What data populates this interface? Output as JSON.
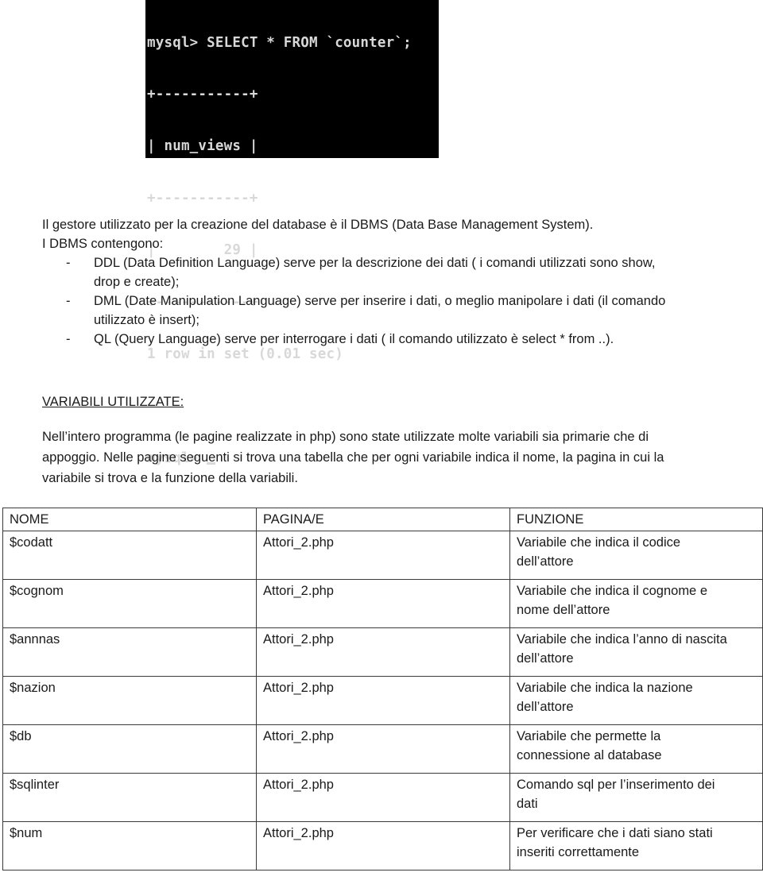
{
  "terminal": {
    "lines": [
      "mysql> SELECT * FROM `counter`;",
      "+-----------+",
      "| num_views |",
      "+-----------+",
      "|        29 |",
      "+-----------+",
      "1 row in set (0.01 sec)",
      "",
      "mysql> "
    ]
  },
  "intro": {
    "line1": "Il gestore utilizzato per la creazione del database è il DBMS (Data Base Management System).",
    "line2": "I DBMS contengono:"
  },
  "bullets": [
    {
      "dash": "-",
      "line1": "DDL  (Data Definition Language)  serve per la descrizione dei dati ( i comandi utilizzati sono show,",
      "line2": "drop e create);"
    },
    {
      "dash": "-",
      "line1": "DML  (Date Manipulation Language) serve per inserire i dati, o meglio manipolare i dati (il comando",
      "line2": "utilizzato è  insert);"
    },
    {
      "dash": "-",
      "line1": "QL  (Query Language) serve per interrogare i dati ( il comando utilizzato è select * from ..).",
      "line2": ""
    }
  ],
  "section": {
    "heading": "VARIABILI  UTILIZZATE:",
    "para_line1": "Nell’intero programma (le pagine realizzate  in php) sono state utilizzate molte variabili sia primarie che di",
    "para_line2": "appoggio. Nelle pagine seguenti si trova una tabella che per ogni variabile indica il nome, la pagina in cui la",
    "para_line3": "variabile si trova e la funzione della variabili."
  },
  "table": {
    "headers": [
      "NOME",
      "PAGINA/E",
      "FUNZIONE"
    ],
    "rows": [
      {
        "nome": "$codatt",
        "pagina": "Attori_2.php",
        "f1": "Variabile che indica il codice",
        "f2": "dell’attore"
      },
      {
        "nome": "$cognom",
        "pagina": "Attori_2.php",
        "f1": "Variabile che indica il cognome e",
        "f2": "nome dell’attore"
      },
      {
        "nome": "$annnas",
        "pagina": "Attori_2.php",
        "f1": "Variabile che indica l’anno di nascita",
        "f2": "dell’attore"
      },
      {
        "nome": "$nazion",
        "pagina": "Attori_2.php",
        "f1": "Variabile che indica la nazione",
        "f2": "dell’attore"
      },
      {
        "nome": "$db",
        "pagina": "Attori_2.php",
        "f1": "Variabile che permette la",
        "f2": "connessione al database"
      },
      {
        "nome": "$sqlinter",
        "pagina": "Attori_2.php",
        "f1": "Comando sql per l’inserimento dei",
        "f2": "dati"
      },
      {
        "nome": "$num",
        "pagina": "Attori_2.php",
        "f1": "Per verificare che i dati siano stati",
        "f2": "inseriti correttamente"
      }
    ]
  }
}
